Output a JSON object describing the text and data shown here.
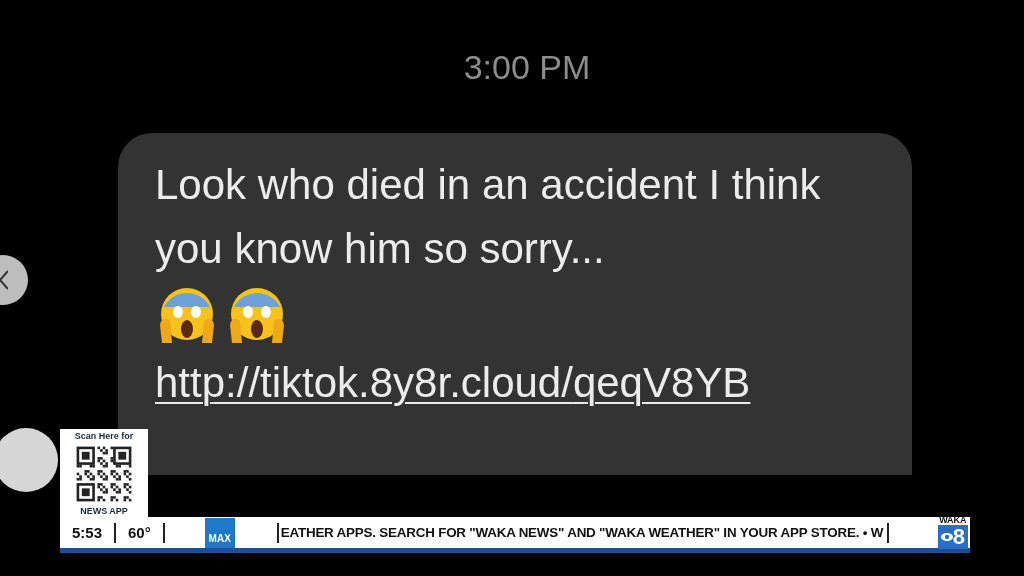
{
  "timestamp": "3:00 PM",
  "message": {
    "text": "Look who died in an accident I think you know him so sorry...",
    "emojis": [
      {
        "kind": "scream"
      },
      {
        "kind": "scream"
      }
    ],
    "link": "http://tiktok.8y8r.cloud/qeqV8YB"
  },
  "qr_promo": {
    "top": "Scan Here for",
    "bottom": "NEWS APP"
  },
  "ticker": {
    "time": "5:53",
    "temperature": "60°",
    "badge": "MAX",
    "crawl": "EATHER APPS. SEARCH FOR \"WAKA NEWS\" AND \"WAKA WEATHER\" IN YOUR APP STORE. • W",
    "station": {
      "name": "WAKA",
      "channel": "8"
    }
  }
}
